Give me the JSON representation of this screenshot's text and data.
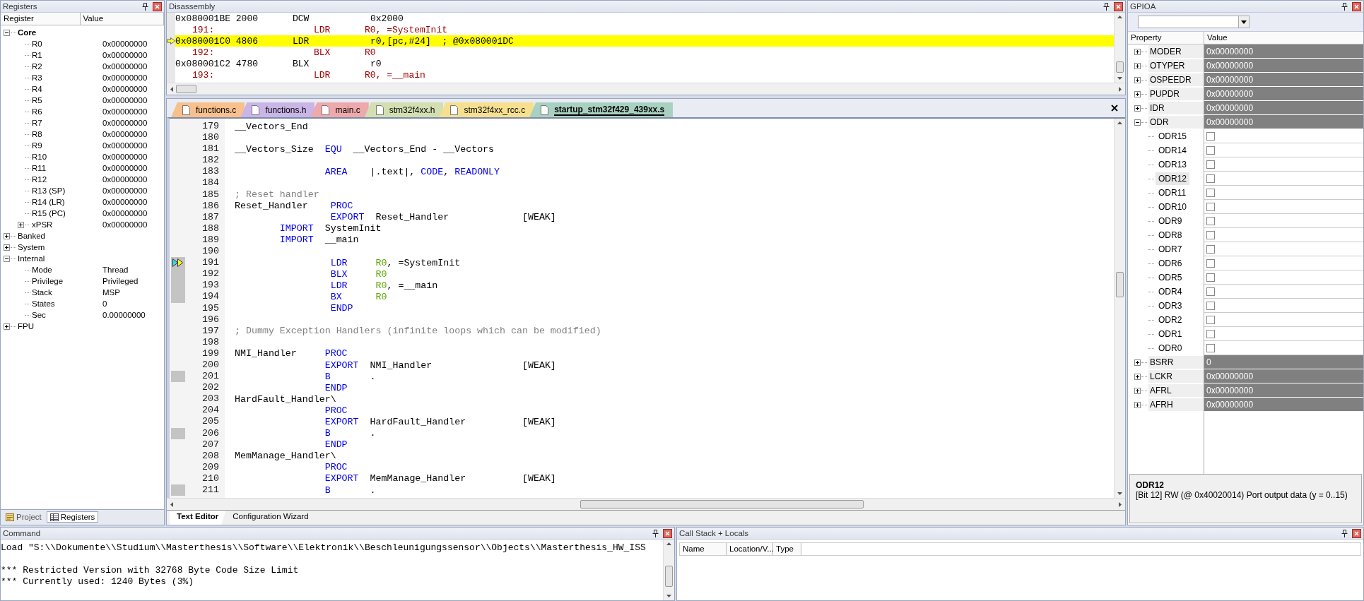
{
  "registers": {
    "title": "Registers",
    "columns": [
      "Register",
      "Value"
    ],
    "tree": [
      {
        "name": "Core",
        "bold": true,
        "expanded": true,
        "children": [
          {
            "name": "R0",
            "value": "0x00000000"
          },
          {
            "name": "R1",
            "value": "0x00000000"
          },
          {
            "name": "R2",
            "value": "0x00000000"
          },
          {
            "name": "R3",
            "value": "0x00000000"
          },
          {
            "name": "R4",
            "value": "0x00000000"
          },
          {
            "name": "R5",
            "value": "0x00000000"
          },
          {
            "name": "R6",
            "value": "0x00000000"
          },
          {
            "name": "R7",
            "value": "0x00000000"
          },
          {
            "name": "R8",
            "value": "0x00000000"
          },
          {
            "name": "R9",
            "value": "0x00000000"
          },
          {
            "name": "R10",
            "value": "0x00000000"
          },
          {
            "name": "R11",
            "value": "0x00000000"
          },
          {
            "name": "R12",
            "value": "0x00000000"
          },
          {
            "name": "R13 (SP)",
            "value": "0x00000000"
          },
          {
            "name": "R14 (LR)",
            "value": "0x00000000"
          },
          {
            "name": "R15 (PC)",
            "value": "0x00000000"
          },
          {
            "name": "xPSR",
            "value": "0x00000000",
            "expanded": false
          }
        ]
      },
      {
        "name": "Banked",
        "bold": false,
        "expanded": false
      },
      {
        "name": "System",
        "bold": false,
        "expanded": false
      },
      {
        "name": "Internal",
        "bold": false,
        "expanded": true,
        "children": [
          {
            "name": "Mode",
            "value": "Thread"
          },
          {
            "name": "Privilege",
            "value": "Privileged"
          },
          {
            "name": "Stack",
            "value": "MSP"
          },
          {
            "name": "States",
            "value": "0"
          },
          {
            "name": "Sec",
            "value": "0.00000000"
          }
        ]
      },
      {
        "name": "FPU",
        "bold": false,
        "expanded": false
      }
    ],
    "tabs": [
      {
        "label": "Project",
        "kind": "project",
        "selected": false
      },
      {
        "label": "Registers",
        "kind": "registers",
        "selected": true
      }
    ]
  },
  "disassembly": {
    "title": "Disassembly",
    "lines": [
      {
        "kind": "asm",
        "address": "0x080001BE 2000",
        "mnemonic": "DCW",
        "operands": "0x2000",
        "current": false
      },
      {
        "kind": "src",
        "address": "191:",
        "mnemonic": "LDR",
        "operands": "R0, =SystemInit",
        "current": false
      },
      {
        "kind": "asm",
        "address": "0x080001C0 4806",
        "mnemonic": "LDR",
        "operands": "r0,[pc,#24]  ; @0x080001DC",
        "current": true
      },
      {
        "kind": "src",
        "address": "192:",
        "mnemonic": "BLX",
        "operands": "R0",
        "current": false
      },
      {
        "kind": "asm",
        "address": "0x080001C2 4780",
        "mnemonic": "BLX",
        "operands": "r0",
        "current": false
      },
      {
        "kind": "src",
        "address": "193:",
        "mnemonic": "LDR",
        "operands": "R0, =__main",
        "current": false
      }
    ]
  },
  "editor": {
    "tabs": [
      {
        "label": "functions.c",
        "color": "#f8c08c",
        "selected": false
      },
      {
        "label": "functions.h",
        "color": "#c9b5e6",
        "selected": false
      },
      {
        "label": "main.c",
        "color": "#eea9ad",
        "selected": false
      },
      {
        "label": "stm32f4xx.h",
        "color": "#d3dfb1",
        "selected": false
      },
      {
        "label": "stm32f4xx_rcc.c",
        "color": "#f6e090",
        "selected": false
      },
      {
        "label": "startup_stm32f429_439xx.s",
        "color": "#a9d1c1",
        "selected": true
      }
    ],
    "lines": [
      {
        "number": "179",
        "exec": false,
        "current": false,
        "segs": [
          {
            "text": "__Vectors_End",
            "kind": "plain"
          }
        ]
      },
      {
        "number": "180",
        "exec": false,
        "current": false
      },
      {
        "number": "181",
        "exec": false,
        "current": false,
        "segs": [
          {
            "text": "__Vectors_Size  ",
            "kind": "plain"
          },
          {
            "text": "EQU",
            "kind": "kw"
          },
          {
            "text": "  __Vectors_End - __Vectors",
            "kind": "plain"
          }
        ]
      },
      {
        "number": "182",
        "exec": false,
        "current": false
      },
      {
        "number": "183",
        "exec": false,
        "current": false,
        "segs": [
          {
            "text": "                AREA",
            "kind": "kw"
          },
          {
            "text": "    |.text|, ",
            "kind": "plain"
          },
          {
            "text": "CODE",
            "kind": "kw"
          },
          {
            "text": ", ",
            "kind": "plain"
          },
          {
            "text": "READONLY",
            "kind": "kw"
          }
        ]
      },
      {
        "number": "184",
        "exec": false,
        "current": false
      },
      {
        "number": "185",
        "exec": false,
        "current": false,
        "segs": [
          {
            "text": "; Reset handler",
            "kind": "comment"
          }
        ]
      },
      {
        "number": "186",
        "exec": false,
        "current": false,
        "segs": [
          {
            "text": "Reset_Handler    ",
            "kind": "plain"
          },
          {
            "text": "PROC",
            "kind": "kw"
          }
        ]
      },
      {
        "number": "187",
        "exec": false,
        "current": false,
        "segs": [
          {
            "text": "                 EXPORT",
            "kind": "kw"
          },
          {
            "text": "  Reset_Handler             [WEAK]",
            "kind": "plain"
          }
        ]
      },
      {
        "number": "188",
        "exec": false,
        "current": false,
        "segs": [
          {
            "text": "        IMPORT",
            "kind": "kw"
          },
          {
            "text": "  SystemInit",
            "kind": "plain"
          }
        ]
      },
      {
        "number": "189",
        "exec": false,
        "current": false,
        "segs": [
          {
            "text": "        IMPORT",
            "kind": "kw"
          },
          {
            "text": "  __main",
            "kind": "plain"
          }
        ]
      },
      {
        "number": "190",
        "exec": false,
        "current": false
      },
      {
        "number": "191",
        "exec": true,
        "current": true,
        "segs": [
          {
            "text": "                 LDR",
            "kind": "kw"
          },
          {
            "text": "     R0",
            "kind": "reg"
          },
          {
            "text": ", =SystemInit",
            "kind": "plain"
          }
        ]
      },
      {
        "number": "192",
        "exec": true,
        "current": false,
        "segs": [
          {
            "text": "                 BLX",
            "kind": "kw"
          },
          {
            "text": "     R0",
            "kind": "reg"
          }
        ]
      },
      {
        "number": "193",
        "exec": true,
        "current": false,
        "segs": [
          {
            "text": "                 LDR",
            "kind": "kw"
          },
          {
            "text": "     R0",
            "kind": "reg"
          },
          {
            "text": ", =__main",
            "kind": "plain"
          }
        ]
      },
      {
        "number": "194",
        "exec": true,
        "current": false,
        "segs": [
          {
            "text": "                 BX",
            "kind": "kw"
          },
          {
            "text": "      R0",
            "kind": "reg"
          }
        ]
      },
      {
        "number": "195",
        "exec": false,
        "current": false,
        "segs": [
          {
            "text": "                 ENDP",
            "kind": "kw"
          }
        ]
      },
      {
        "number": "196",
        "exec": false,
        "current": false
      },
      {
        "number": "197",
        "exec": false,
        "current": false,
        "segs": [
          {
            "text": "; Dummy Exception Handlers (infinite loops which can be modified)",
            "kind": "comment"
          }
        ]
      },
      {
        "number": "198",
        "exec": false,
        "current": false
      },
      {
        "number": "199",
        "exec": false,
        "current": false,
        "segs": [
          {
            "text": "NMI_Handler     ",
            "kind": "plain"
          },
          {
            "text": "PROC",
            "kind": "kw"
          }
        ]
      },
      {
        "number": "200",
        "exec": false,
        "current": false,
        "segs": [
          {
            "text": "                EXPORT",
            "kind": "kw"
          },
          {
            "text": "  NMI_Handler                [WEAK]",
            "kind": "plain"
          }
        ]
      },
      {
        "number": "201",
        "exec": true,
        "current": false,
        "segs": [
          {
            "text": "                B",
            "kind": "kw"
          },
          {
            "text": "       .",
            "kind": "plain"
          }
        ]
      },
      {
        "number": "202",
        "exec": false,
        "current": false,
        "segs": [
          {
            "text": "                ENDP",
            "kind": "kw"
          }
        ]
      },
      {
        "number": "203",
        "exec": false,
        "current": false,
        "segs": [
          {
            "text": "HardFault_Handler\\",
            "kind": "plain"
          }
        ]
      },
      {
        "number": "204",
        "exec": false,
        "current": false,
        "segs": [
          {
            "text": "                PROC",
            "kind": "kw"
          }
        ]
      },
      {
        "number": "205",
        "exec": false,
        "current": false,
        "segs": [
          {
            "text": "                EXPORT",
            "kind": "kw"
          },
          {
            "text": "  HardFault_Handler          [WEAK]",
            "kind": "plain"
          }
        ]
      },
      {
        "number": "206",
        "exec": true,
        "current": false,
        "segs": [
          {
            "text": "                B",
            "kind": "kw"
          },
          {
            "text": "       .",
            "kind": "plain"
          }
        ]
      },
      {
        "number": "207",
        "exec": false,
        "current": false,
        "segs": [
          {
            "text": "                ENDP",
            "kind": "kw"
          }
        ]
      },
      {
        "number": "208",
        "exec": false,
        "current": false,
        "segs": [
          {
            "text": "MemManage_Handler\\",
            "kind": "plain"
          }
        ]
      },
      {
        "number": "209",
        "exec": false,
        "current": false,
        "segs": [
          {
            "text": "                PROC",
            "kind": "kw"
          }
        ]
      },
      {
        "number": "210",
        "exec": false,
        "current": false,
        "segs": [
          {
            "text": "                EXPORT",
            "kind": "kw"
          },
          {
            "text": "  MemManage_Handler          [WEAK]",
            "kind": "plain"
          }
        ]
      },
      {
        "number": "211",
        "exec": true,
        "current": false,
        "segs": [
          {
            "text": "                B",
            "kind": "kw"
          },
          {
            "text": "       .",
            "kind": "plain"
          }
        ]
      }
    ],
    "view_tabs": [
      {
        "label": "Text Editor",
        "selected": true
      },
      {
        "label": "Configuration Wizard",
        "selected": false
      }
    ]
  },
  "gpio": {
    "title": "GPIOA",
    "columns": [
      "Property",
      "Value"
    ],
    "rows": [
      {
        "name": "MODER",
        "value": "0x00000000",
        "expanded": false,
        "selected": false
      },
      {
        "name": "OTYPER",
        "value": "0x00000000",
        "expanded": false,
        "selected": false
      },
      {
        "name": "OSPEEDR",
        "value": "0x00000000",
        "expanded": false,
        "selected": false
      },
      {
        "name": "PUPDR",
        "value": "0x00000000",
        "expanded": false,
        "selected": false
      },
      {
        "name": "IDR",
        "value": "0x00000000",
        "expanded": false,
        "selected": false
      },
      {
        "name": "ODR",
        "value": "0x00000000",
        "expanded": true,
        "selected": false,
        "children": [
          {
            "name": "ODR15",
            "checked": false,
            "selected": false
          },
          {
            "name": "ODR14",
            "checked": false,
            "selected": false
          },
          {
            "name": "ODR13",
            "checked": false,
            "selected": false
          },
          {
            "name": "ODR12",
            "checked": false,
            "selected": true
          },
          {
            "name": "ODR11",
            "checked": false,
            "selected": false
          },
          {
            "name": "ODR10",
            "checked": false,
            "selected": false
          },
          {
            "name": "ODR9",
            "checked": false,
            "selected": false
          },
          {
            "name": "ODR8",
            "checked": false,
            "selected": false
          },
          {
            "name": "ODR7",
            "checked": false,
            "selected": false
          },
          {
            "name": "ODR6",
            "checked": false,
            "selected": false
          },
          {
            "name": "ODR5",
            "checked": false,
            "selected": false
          },
          {
            "name": "ODR4",
            "checked": false,
            "selected": false
          },
          {
            "name": "ODR3",
            "checked": false,
            "selected": false
          },
          {
            "name": "ODR2",
            "checked": false,
            "selected": false
          },
          {
            "name": "ODR1",
            "checked": false,
            "selected": false
          },
          {
            "name": "ODR0",
            "checked": false,
            "selected": false
          }
        ]
      },
      {
        "name": "BSRR",
        "value": "0",
        "expanded": false,
        "selected": false
      },
      {
        "name": "LCKR",
        "value": "0x00000000",
        "expanded": false,
        "selected": false
      },
      {
        "name": "AFRL",
        "value": "0x00000000",
        "expanded": false,
        "selected": false
      },
      {
        "name": "AFRH",
        "value": "0x00000000",
        "expanded": false,
        "selected": false
      }
    ],
    "description": {
      "title": "ODR12",
      "text": "[Bit 12] RW (@ 0x40020014) Port output data (y = 0..15)"
    }
  },
  "command": {
    "title": "Command",
    "lines": [
      "Load \"S:\\\\Dokumente\\\\Studium\\\\Masterthesis\\\\Software\\\\Elektronik\\\\Beschleunigungssensor\\\\Objects\\\\Masterthesis_HW_ISS",
      "*** Restricted Version with 32768 Byte Code Size Limit",
      "*** Currently used: 1240 Bytes (3%)"
    ]
  },
  "call_stack": {
    "title": "Call Stack + Locals",
    "columns": [
      "Name",
      "Location/V...",
      "Type"
    ]
  }
}
